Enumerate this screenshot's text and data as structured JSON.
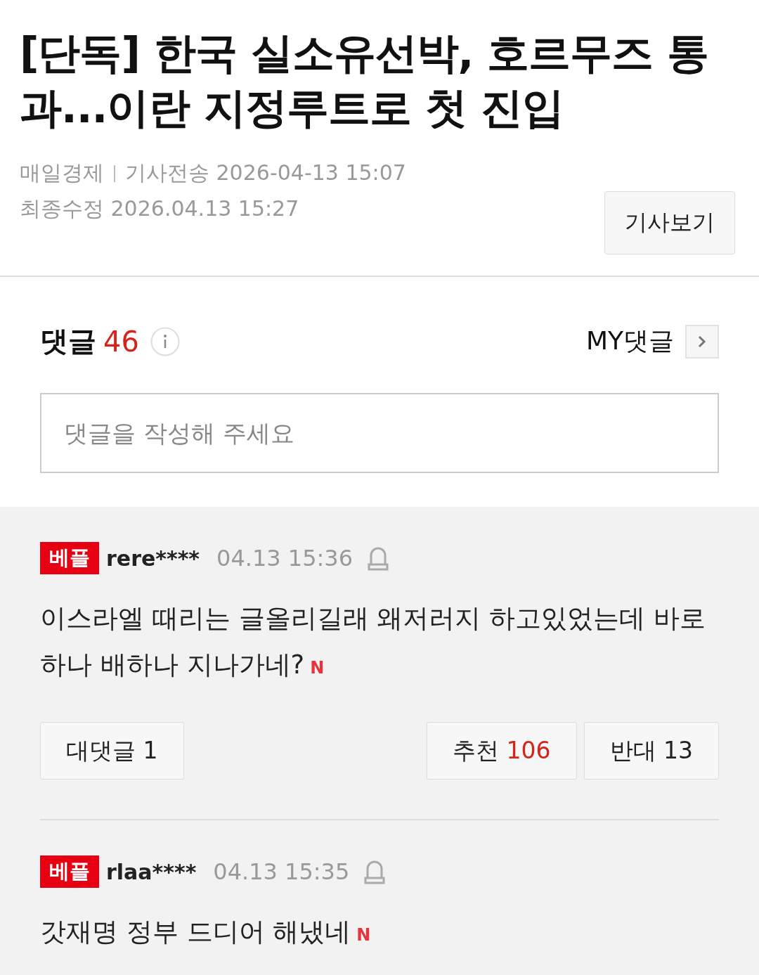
{
  "article": {
    "title": "[단독] 한국 실소유선박, 호르무즈 통과...이란 지정루트로 첫 진입",
    "publisher": "매일경제",
    "sent": "기사전송 2026-04-13 15:07",
    "modified": "최종수정 2026.04.13 15:27",
    "view_button": "기사보기"
  },
  "comments_header": {
    "label": "댓글",
    "count": "46",
    "my_comments": "MY댓글"
  },
  "comment_input": {
    "placeholder": "댓글을 작성해 주세요"
  },
  "comments": [
    {
      "badge": "베플",
      "user": "rere****",
      "time": "04.13 15:36",
      "text": "이스라엘 때리는 글올리길래 왜저러지 하고있었는데 바로 하나 배하나 지나가네?",
      "new_badge": "N",
      "reply_button": "대댓글 1",
      "like_label": "추천",
      "like_count": "106",
      "dislike_button": "반대 13"
    },
    {
      "badge": "베플",
      "user": "rlaa****",
      "time": "04.13 15:35",
      "text": "갓재명 정부 드디어 해냈네",
      "new_badge": "N"
    }
  ]
}
